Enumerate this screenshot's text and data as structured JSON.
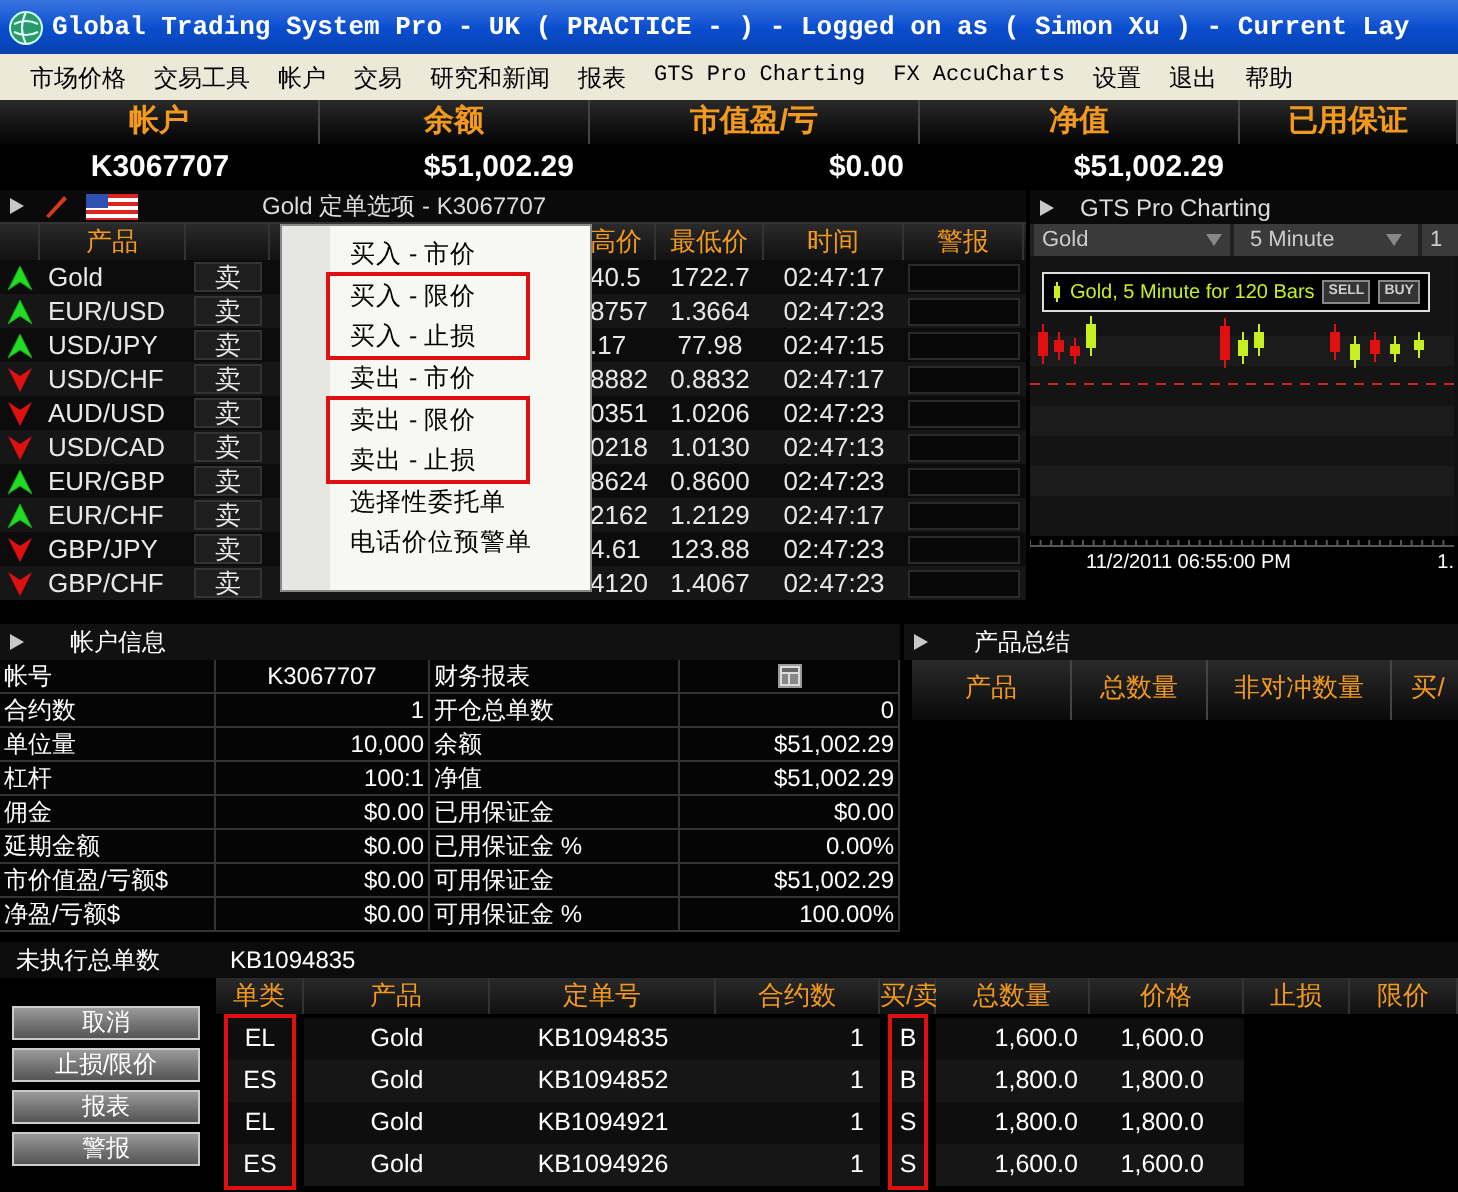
{
  "window": {
    "title": "Global Trading System Pro - UK ( PRACTICE -  ) - Logged on as ( Simon Xu ) - Current Lay"
  },
  "menu": [
    "市场价格",
    "交易工具",
    "帐户",
    "交易",
    "研究和新闻",
    "报表",
    "GTS Pro Charting",
    "FX AccuCharts",
    "设置",
    "退出",
    "帮助"
  ],
  "account_summary": {
    "columns": [
      "帐户",
      "余额",
      "市值盈/亏",
      "净值",
      "已用保证"
    ],
    "values": [
      "K3067707",
      "$51,002.29",
      "$0.00",
      "$51,002.29"
    ]
  },
  "quotes_panel": {
    "title": "Gold 定单选项 - K3067707",
    "columns": [
      "产品",
      "高价",
      "最低价",
      "时间",
      "警报"
    ],
    "rows": [
      {
        "rising": true,
        "product": "Gold",
        "action": "卖",
        "high": "40.5",
        "low": "1722.7",
        "time": "02:47:17"
      },
      {
        "rising": true,
        "product": "EUR/USD",
        "action": "卖",
        "high": "8757",
        "low": "1.3664",
        "time": "02:47:23"
      },
      {
        "rising": true,
        "product": "USD/JPY",
        "action": "卖",
        "high": ".17",
        "low": "77.98",
        "time": "02:47:15"
      },
      {
        "rising": false,
        "product": "USD/CHF",
        "action": "卖",
        "high": "8882",
        "low": "0.8832",
        "time": "02:47:17"
      },
      {
        "rising": false,
        "product": "AUD/USD",
        "action": "卖",
        "high": "0351",
        "low": "1.0206",
        "time": "02:47:23"
      },
      {
        "rising": false,
        "product": "USD/CAD",
        "action": "卖",
        "high": "0218",
        "low": "1.0130",
        "time": "02:47:13"
      },
      {
        "rising": true,
        "product": "EUR/GBP",
        "action": "卖",
        "high": "8624",
        "low": "0.8600",
        "time": "02:47:23"
      },
      {
        "rising": true,
        "product": "EUR/CHF",
        "action": "卖",
        "high": "2162",
        "low": "1.2129",
        "time": "02:47:17"
      },
      {
        "rising": false,
        "product": "GBP/JPY",
        "action": "卖",
        "high": "4.61",
        "low": "123.88",
        "time": "02:47:23"
      },
      {
        "rising": false,
        "product": "GBP/CHF",
        "action": "卖",
        "high": "4120",
        "low": "1.4067",
        "time": "02:47:23"
      }
    ]
  },
  "context_menu": {
    "groups": [
      {
        "highlighted": false,
        "items": [
          "买入 - 市价"
        ]
      },
      {
        "highlighted": true,
        "items": [
          "买入 - 限价",
          "买入 - 止损"
        ]
      },
      {
        "highlighted": false,
        "items": [
          "卖出 - 市价"
        ]
      },
      {
        "highlighted": true,
        "items": [
          "卖出 - 限价",
          "卖出 - 止损"
        ]
      },
      {
        "highlighted": false,
        "items": [
          "选择性委托单",
          "电话价位预警单"
        ]
      }
    ]
  },
  "chart_panel": {
    "title": "GTS Pro Charting",
    "symbol": "Gold",
    "interval": "5 Minute",
    "toolbar_3": "1",
    "legend": "Gold, 5 Minute for 120 Bars",
    "buttons": [
      "SELL",
      "BUY"
    ],
    "time_labels": [
      "11/2/2011 06:55:00 PM",
      "1."
    ]
  },
  "account_info": {
    "title": "帐户信息",
    "rows": [
      {
        "kind": "icon",
        "label": "帐号",
        "value": "K3067707",
        "label_2": "财务报表"
      },
      {
        "kind": "text",
        "label": "合约数",
        "value": "1",
        "label_2": "开仓总单数",
        "value_2": "0"
      },
      {
        "kind": "text",
        "label": "单位量",
        "value": "10,000",
        "label_2": "余额",
        "value_2": "$51,002.29"
      },
      {
        "kind": "text",
        "label": "杠杆",
        "value": "100:1",
        "label_2": "净值",
        "value_2": "$51,002.29"
      },
      {
        "kind": "text",
        "label": "佣金",
        "value": "$0.00",
        "label_2": "已用保证金",
        "value_2": "$0.00"
      },
      {
        "kind": "text",
        "label": "延期金额",
        "value": "$0.00",
        "label_2": "已用保证金 %",
        "value_2": "0.00%"
      },
      {
        "kind": "text",
        "label": "市价值盈/亏额$",
        "value": "$0.00",
        "label_2": "可用保证金",
        "value_2": "$51,002.29"
      },
      {
        "kind": "text",
        "label": "净盈/亏额$",
        "value": "$0.00",
        "label_2": "可用保证金 %",
        "value_2": "100.00%"
      }
    ]
  },
  "product_summary": {
    "title": "产品总结",
    "columns": [
      "产品",
      "总数量",
      "非对冲数量",
      "买/"
    ]
  },
  "pending_orders": {
    "label": "未执行总单数",
    "order_id": "KB1094835",
    "buttons": [
      "取消",
      "止损/限价",
      "报表",
      "警报"
    ],
    "columns": [
      {
        "label": "单类",
        "highlighted": true
      },
      {
        "label": "产品",
        "highlighted": false
      },
      {
        "label": "定单号",
        "highlighted": false
      },
      {
        "label": "合约数",
        "highlighted": false
      },
      {
        "label": "买/卖",
        "highlighted": true
      },
      {
        "label": "总数量",
        "highlighted": false
      },
      {
        "label": "价格",
        "highlighted": false
      },
      {
        "label": "止损",
        "highlighted": false
      },
      {
        "label": "限价",
        "highlighted": false
      }
    ],
    "rows": [
      [
        "EL",
        "Gold",
        "KB1094835",
        "1",
        "B",
        "1,600.0",
        "1,600.0"
      ],
      [
        "ES",
        "Gold",
        "KB1094852",
        "1",
        "B",
        "1,800.0",
        "1,800.0"
      ],
      [
        "EL",
        "Gold",
        "KB1094921",
        "1",
        "S",
        "1,800.0",
        "1,800.0"
      ],
      [
        "ES",
        "Gold",
        "KB1094926",
        "1",
        "S",
        "1,600.0",
        "1,600.0"
      ]
    ]
  }
}
